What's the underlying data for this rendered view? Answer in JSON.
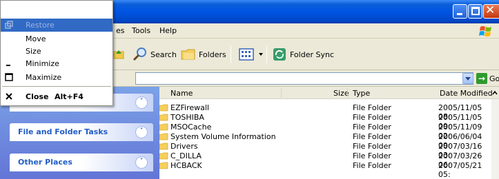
{
  "window": {
    "title": "",
    "buttons": {
      "minimize": "minimize-icon",
      "maximize": "maximize-icon",
      "close": "close-icon"
    }
  },
  "menubar": {
    "items": [
      "es",
      "Tools",
      "Help"
    ]
  },
  "toolbar": {
    "search_label": "Search",
    "folders_label": "Folders",
    "folder_sync_label": "Folder Sync"
  },
  "address": {
    "value": "",
    "go_label": "Go"
  },
  "system_menu": {
    "items": [
      {
        "label": "Restore",
        "icon": "restore-icon",
        "enabled": false
      },
      {
        "label": "Move",
        "icon": "",
        "enabled": true
      },
      {
        "label": "Size",
        "icon": "",
        "enabled": true
      },
      {
        "label": "Minimize",
        "icon": "minimize-icon",
        "enabled": true
      },
      {
        "label": "Maximize",
        "icon": "maximize-icon",
        "enabled": true
      },
      {
        "label": "Close",
        "accelerator": "Alt+F4",
        "icon": "close-icon",
        "enabled": true
      }
    ]
  },
  "task_pane": {
    "sections": [
      {
        "title": "File and Folder Tasks"
      },
      {
        "title": "Other Places"
      }
    ]
  },
  "file_list": {
    "columns": [
      "Name",
      "Size",
      "Type",
      "Date Modified"
    ],
    "rows": [
      {
        "name": "EZFirewall",
        "size": "",
        "type": "File Folder",
        "date": "2005/11/05 08:"
      },
      {
        "name": "TOSHIBA",
        "size": "",
        "type": "File Folder",
        "date": "2005/11/05 09:"
      },
      {
        "name": "MSOCache",
        "size": "",
        "type": "File Folder",
        "date": "2005/11/09 02:"
      },
      {
        "name": "System Volume Information",
        "size": "",
        "type": "File Folder",
        "date": "2006/06/04 09:"
      },
      {
        "name": "Drivers",
        "size": "",
        "type": "File Folder",
        "date": "2007/03/16 03:"
      },
      {
        "name": "C_DILLA",
        "size": "",
        "type": "File Folder",
        "date": "2007/03/26 06:"
      },
      {
        "name": "HCBACK",
        "size": "",
        "type": "File Folder",
        "date": "2007/05/21 05:"
      }
    ]
  },
  "colors": {
    "titlebar": "#0054e3",
    "menu_highlight": "#316ac5",
    "task_pane_bg": "#6375d6",
    "task_title": "#215dc6"
  }
}
